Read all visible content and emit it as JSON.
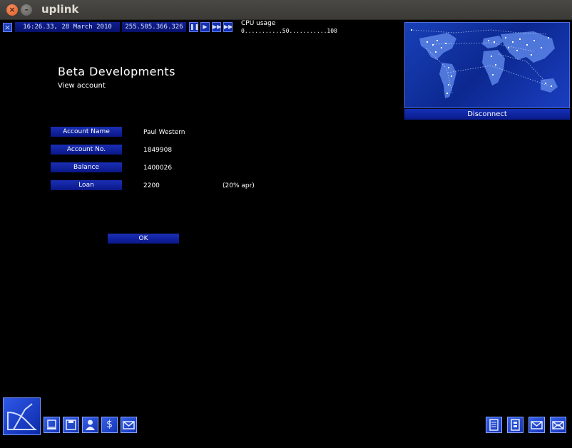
{
  "window": {
    "title": "uplink"
  },
  "hud": {
    "datetime": "16:26.33, 28 March 2010",
    "ip": "255.505.366.326",
    "cpu_label": "CPU usage",
    "cpu_scale": "0...........50...........100"
  },
  "map": {
    "disconnect_label": "Disconnect"
  },
  "page": {
    "company": "Beta Developments",
    "subtitle": "View account"
  },
  "account": {
    "rows": [
      {
        "label": "Account Name",
        "value": "Paul Western",
        "extra": ""
      },
      {
        "label": "Account No.",
        "value": "1849908",
        "extra": ""
      },
      {
        "label": "Balance",
        "value": "1400026",
        "extra": ""
      },
      {
        "label": "Loan",
        "value": "2200",
        "extra": "(20% apr)"
      }
    ],
    "ok_label": "OK"
  },
  "icons": {
    "left": [
      "gateway-icon",
      "computer-icon",
      "save-icon",
      "agent-icon",
      "finance-icon",
      "email-icon"
    ],
    "right": [
      "notes-icon",
      "memory-icon",
      "mail-icon",
      "send-mail-icon"
    ]
  },
  "colors": {
    "accent": "#1430b0",
    "background": "#000000"
  }
}
